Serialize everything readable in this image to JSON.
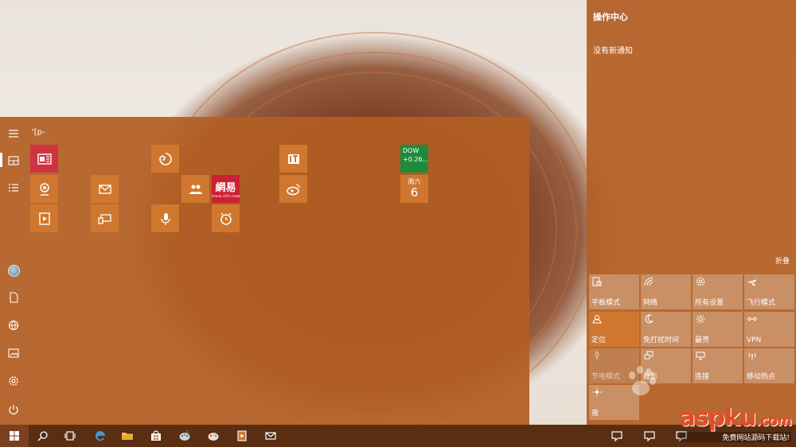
{
  "start_menu": {
    "group_label": "'[p-",
    "tiles": {
      "dow_line1": "DOW",
      "dow_line2": "+0.26...",
      "calendar_weekday": "周六",
      "calendar_day": "6",
      "netease_label": "網易",
      "netease_sub": "www.163.com"
    }
  },
  "action_center": {
    "title": "操作中心",
    "empty_text": "没有新通知",
    "collapse": "折叠",
    "quick_actions": [
      {
        "label": "平板模式",
        "icon": "tablet-mode-icon"
      },
      {
        "label": "网络",
        "icon": "network-icon"
      },
      {
        "label": "所有设置",
        "icon": "settings-icon"
      },
      {
        "label": "飞行模式",
        "icon": "airplane-icon"
      },
      {
        "label": "定位",
        "icon": "location-icon"
      },
      {
        "label": "免打扰时间",
        "icon": "moon-icon"
      },
      {
        "label": "最亮",
        "icon": "brightness-icon"
      },
      {
        "label": "VPN",
        "icon": "vpn-icon"
      },
      {
        "label": "节电模式",
        "icon": "battery-saver-icon"
      },
      {
        "label": "投影",
        "icon": "project-icon"
      },
      {
        "label": "连接",
        "icon": "connect-icon"
      },
      {
        "label": "移动热点",
        "icon": "hotspot-icon"
      },
      {
        "label": "夜",
        "icon": "night-light-icon"
      }
    ]
  },
  "watermark": {
    "brand": "aspku",
    "brand_suffix": ".com",
    "tagline": "免费网站源码下载站!"
  },
  "colors": {
    "accent": "#d0772f",
    "panel": "#b35f23",
    "taskbar": "#5a2e12",
    "tile_red": "#d03340",
    "tile_green": "#1f8a3c"
  }
}
